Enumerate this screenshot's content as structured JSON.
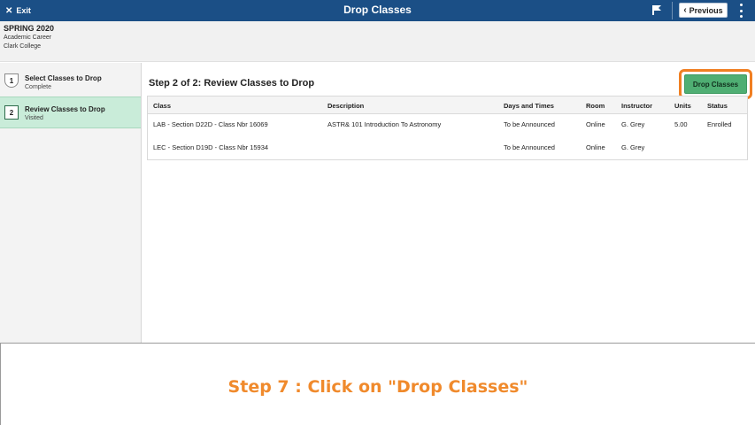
{
  "topbar": {
    "exit_label": "Exit",
    "title": "Drop Classes",
    "previous_label": "Previous"
  },
  "header": {
    "term": "SPRING 2020",
    "career": "Academic Career",
    "college": "Clark College"
  },
  "sidebar": {
    "steps": [
      {
        "number": "1",
        "label": "Select Classes to Drop",
        "status": "Complete"
      },
      {
        "number": "2",
        "label": "Review Classes to Drop",
        "status": "Visited"
      }
    ]
  },
  "main": {
    "title": "Step 2 of 2: Review Classes to Drop",
    "drop_button_label": "Drop Classes",
    "columns": [
      "Class",
      "Description",
      "Days and Times",
      "Room",
      "Instructor",
      "Units",
      "Status"
    ],
    "rows": [
      {
        "class_prefix": "LAB - Section D22D - ",
        "class_nbr": "Class Nbr 16069",
        "description": "ASTR& 101  Introduction To Astronomy",
        "days_times": "To be Announced",
        "room": "Online",
        "instructor": "G. Grey",
        "units": "5.00",
        "status": "Enrolled"
      },
      {
        "class_prefix": "LEC - Section D19D - ",
        "class_nbr": "Class Nbr 15934",
        "description": "",
        "days_times": "To be Announced",
        "room": "Online",
        "instructor": "G. Grey",
        "units": "",
        "status": ""
      }
    ]
  },
  "caption": "Step 7 : Click on \"Drop Classes\"",
  "colors": {
    "topbar": "#1b4f86",
    "drop_button": "#4fae73",
    "highlight": "#f07f22",
    "active_step": "#c9ecd9"
  }
}
